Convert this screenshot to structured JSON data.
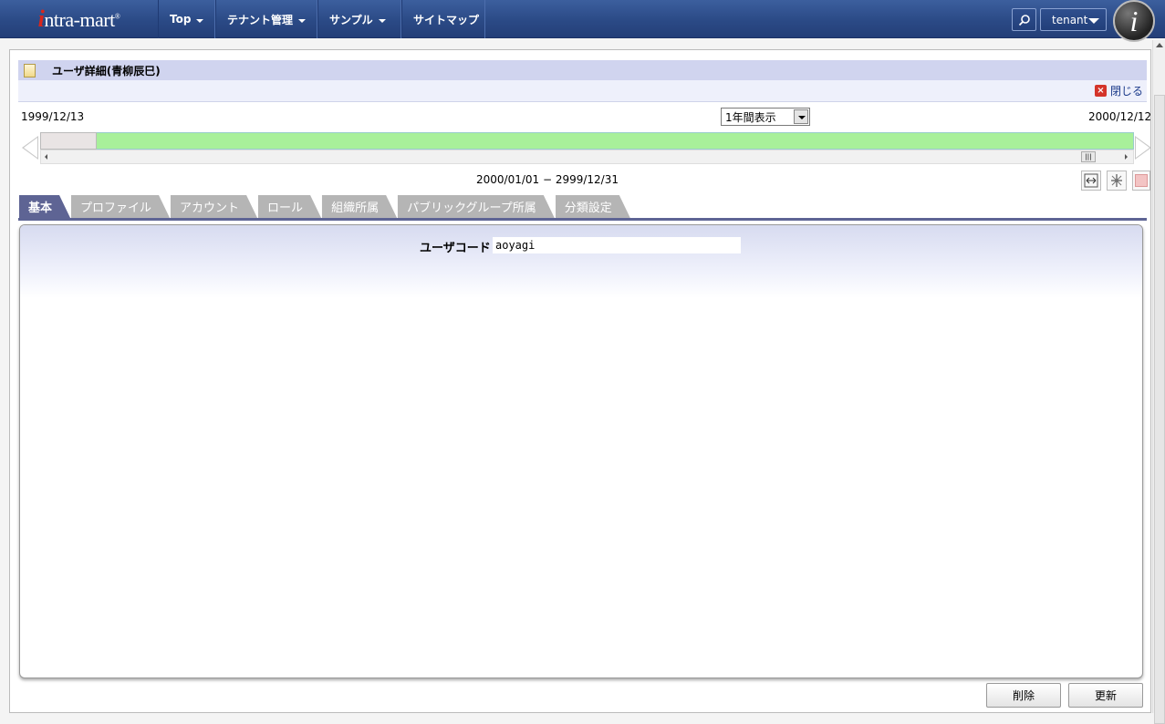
{
  "nav": {
    "logo": "intra-mart",
    "items": [
      {
        "label": "Top",
        "has_caret": true
      },
      {
        "label": "テナント管理",
        "has_caret": true
      },
      {
        "label": "サンプル",
        "has_caret": true
      },
      {
        "label": "サイトマップ",
        "has_caret": false
      }
    ],
    "tenant": "tenant",
    "search_icon": "search-icon",
    "avatar_letter": "i"
  },
  "page": {
    "title": "ユーザ詳細(青柳辰巳)",
    "close_label": "閉じる"
  },
  "timeline": {
    "start_date": "1999/12/13",
    "end_date": "2000/12/12",
    "range_select": "1年間表示",
    "active_range": "2000/01/01 − 2999/12/31"
  },
  "tabs": [
    {
      "label": "基本",
      "active": true
    },
    {
      "label": "プロファイル",
      "active": false
    },
    {
      "label": "アカウント",
      "active": false
    },
    {
      "label": "ロール",
      "active": false
    },
    {
      "label": "組織所属",
      "active": false
    },
    {
      "label": "パブリックグループ所属",
      "active": false
    },
    {
      "label": "分類設定",
      "active": false
    }
  ],
  "form": {
    "user_code_label": "ユーザコード",
    "user_code_value": "aoyagi"
  },
  "buttons": {
    "delete": "削除",
    "update": "更新"
  },
  "colors": {
    "nav_bg": "#2b4a86",
    "tab_active": "#5e6494",
    "timeline_green": "#a8f09a"
  }
}
